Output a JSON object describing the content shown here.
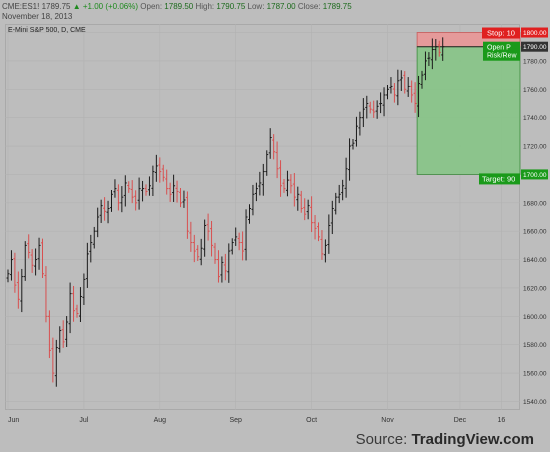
{
  "header": {
    "symbol": "CME:ES1!",
    "last": "1789.75",
    "change": "▲ +1.00 (+0.06%)",
    "open_label": "Open:",
    "open": "1789.50",
    "high_label": "High:",
    "high": "1790.75",
    "low_label": "Low:",
    "low": "1787.00",
    "close_label": "Close:",
    "close": "1789.75",
    "date": "November 18, 2013"
  },
  "footer": {
    "source_prefix": "Source: ",
    "source_brand": "TradingView.com"
  },
  "colors": {
    "up_bar": "#1a1a1a",
    "down_bar": "#d84f4f",
    "stop_zone": "#e59a9a",
    "target_zone": "#86c486",
    "stop_label_bg": "#e02020",
    "target_label_bg": "#1a9a1a",
    "price_tag_bg": "#333333"
  },
  "chart_data": {
    "type": "ohlc",
    "title": "E-Mini S&P 500, D, CME",
    "ylim": [
      1534,
      1806
    ],
    "y_ticks": [
      1800,
      1780,
      1760,
      1740,
      1720,
      1700,
      1680,
      1660,
      1640,
      1620,
      1600,
      1580,
      1560,
      1540
    ],
    "y_tick_labels": [
      "1800.00",
      "1780.00",
      "1760.00",
      "1740.00",
      "1720.00",
      "1700.00",
      "1680.00",
      "1660.00",
      "1640.00",
      "1620.00",
      "1600.00",
      "1580.00",
      "1560.00",
      "1540.00"
    ],
    "x_labels": [
      "Jun",
      "Jul",
      "Aug",
      "Sep",
      "Oct",
      "Nov",
      "Dec",
      "16"
    ],
    "x_label_bar_index": [
      0,
      22,
      44,
      66,
      88,
      110,
      131,
      143
    ],
    "last_price_label": "1790.00",
    "long_position": {
      "entry": 1790.0,
      "stop": 1800.0,
      "target": 1700.0,
      "stop_label": "Stop: 10",
      "target_label": "Target: 90",
      "stop_price_label": "1800.00",
      "target_price_label": "1700.00",
      "info_lines": [
        "Open P",
        "Risk/Rew"
      ],
      "start_bar_index": 118
    },
    "closes": [
      1630,
      1640,
      1622,
      1612,
      1628,
      1650,
      1645,
      1636,
      1640,
      1650,
      1630,
      1600,
      1576,
      1560,
      1578,
      1590,
      1582,
      1596,
      1616,
      1604,
      1602,
      1614,
      1626,
      1644,
      1652,
      1660,
      1670,
      1678,
      1674,
      1676,
      1686,
      1690,
      1680,
      1684,
      1694,
      1690,
      1684,
      1680,
      1690,
      1690,
      1688,
      1692,
      1702,
      1706,
      1702,
      1698,
      1690,
      1686,
      1692,
      1688,
      1680,
      1682,
      1660,
      1652,
      1646,
      1642,
      1648,
      1664,
      1660,
      1650,
      1640,
      1628,
      1638,
      1632,
      1646,
      1652,
      1656,
      1652,
      1646,
      1670,
      1676,
      1686,
      1690,
      1694,
      1702,
      1714,
      1726,
      1716,
      1704,
      1692,
      1690,
      1696,
      1692,
      1684,
      1686,
      1676,
      1672,
      1678,
      1666,
      1662,
      1656,
      1644,
      1650,
      1664,
      1676,
      1684,
      1686,
      1692,
      1704,
      1720,
      1722,
      1734,
      1740,
      1746,
      1750,
      1746,
      1744,
      1748,
      1750,
      1756,
      1760,
      1762,
      1756,
      1766,
      1768,
      1760,
      1762,
      1756,
      1750,
      1764,
      1770,
      1780,
      1782,
      1788,
      1790,
      1786,
      1790
    ]
  }
}
